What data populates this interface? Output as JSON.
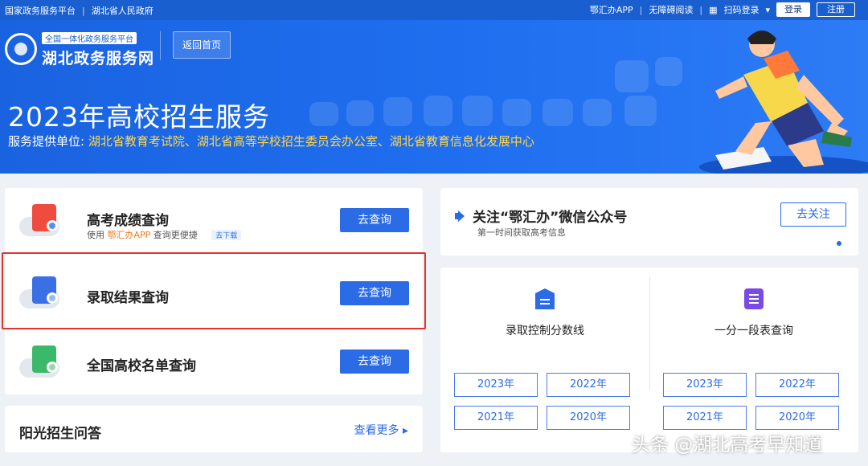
{
  "topbar": {
    "left": [
      "国家政务服务平台",
      "湖北省人民政府"
    ],
    "right": [
      "鄂汇办APP",
      "无障碍阅读",
      "扫码登录"
    ],
    "login": "登录",
    "register": "注册"
  },
  "banner": {
    "logo_tag": "全国一体化政务服务平台",
    "logo_name": "湖北政务服务网",
    "home_button": "返回首页",
    "title": "2023年高校招生服务",
    "provider_label": "服务提供单位:",
    "provider_value": "湖北省教育考试院、湖北省高等学校招生委员会办公室、湖北省教育信息化发展中心"
  },
  "query_rows": [
    {
      "title": "高考成绩查询",
      "sub_pre": "使用",
      "sub_app": "鄂汇办APP",
      "sub_post": "查询更便捷",
      "download": "去下载",
      "button": "去查询"
    },
    {
      "title": "录取结果查询",
      "button": "去查询"
    },
    {
      "title": "全国高校名单查询",
      "button": "去查询"
    }
  ],
  "qa": {
    "title": "阳光招生问答",
    "more": "查看更多"
  },
  "wechat": {
    "title": "关注“鄂汇办”微信公众号",
    "subtitle": "第一时间获取高考信息",
    "button": "去关注"
  },
  "score_sections": [
    {
      "title": "录取控制分数线",
      "years": [
        "2023年",
        "2022年",
        "2021年",
        "2020年"
      ]
    },
    {
      "title": "一分一段表查询",
      "years": [
        "2023年",
        "2022年",
        "2021年",
        "2020年"
      ]
    }
  ],
  "watermark": "头条 @湖北高考早知道",
  "colors": {
    "primary": "#2b6be6",
    "banner": "#1a63e0",
    "highlight": "#e0332b",
    "accent": "#ffd74a"
  }
}
